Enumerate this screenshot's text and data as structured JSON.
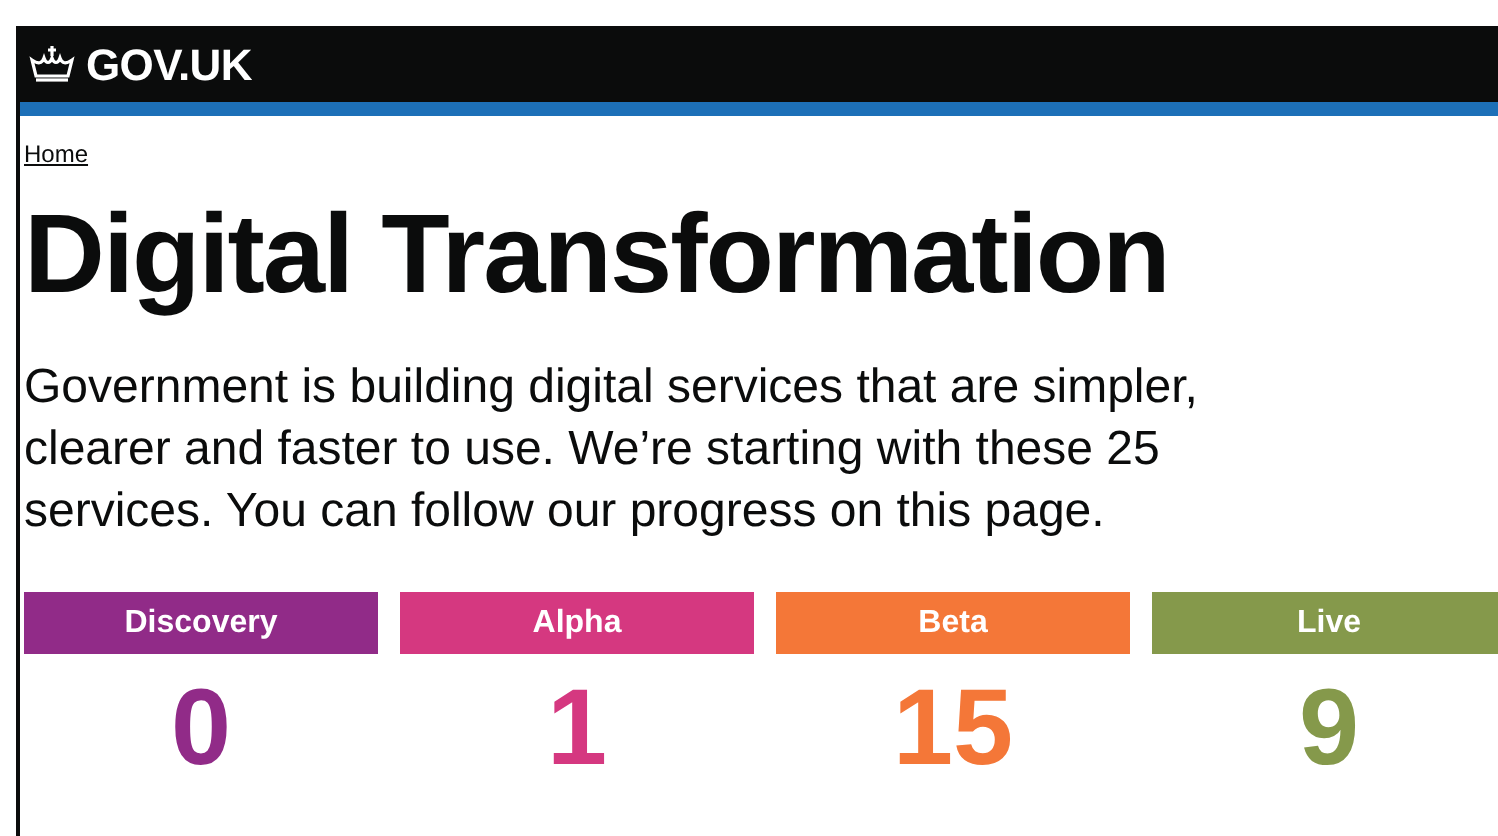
{
  "header": {
    "logo_text": "GOV.UK"
  },
  "breadcrumb": [
    "Home"
  ],
  "title": "Digital Transformation",
  "intro": "Government is building digital services that are simpler, clearer and faster to use. We’re starting with these 25 services. You can follow our progress on this page.",
  "stages": [
    {
      "label": "Discovery",
      "count": "0",
      "color": "#912b88"
    },
    {
      "label": "Alpha",
      "count": "1",
      "color": "#d53880"
    },
    {
      "label": "Beta",
      "count": "15",
      "color": "#f47738"
    },
    {
      "label": "Live",
      "count": "9",
      "color": "#85994b"
    }
  ]
}
